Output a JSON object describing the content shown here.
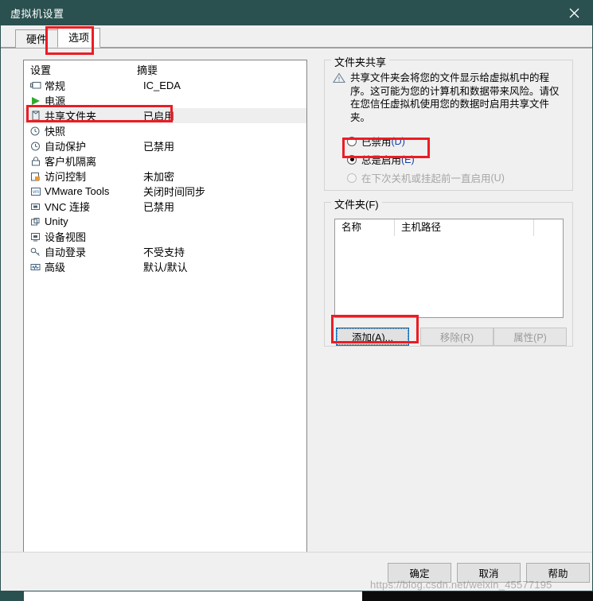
{
  "window": {
    "title": "虚拟机设置",
    "close_icon": "close-icon"
  },
  "tabs": [
    {
      "label": "硬件",
      "active": false
    },
    {
      "label": "选项",
      "active": true
    }
  ],
  "settings_list": {
    "headers": {
      "name": "设置",
      "summary": "摘要"
    },
    "rows": [
      {
        "icon": "monitor-icon",
        "label": "常规",
        "summary": "IC_EDA",
        "selected": false
      },
      {
        "icon": "power-play-icon",
        "label": "电源",
        "summary": "",
        "selected": false
      },
      {
        "icon": "folder-icon",
        "label": "共享文件夹",
        "summary": "已启用",
        "selected": true
      },
      {
        "icon": "snapshot-icon",
        "label": "快照",
        "summary": "",
        "selected": false
      },
      {
        "icon": "clock-icon",
        "label": "自动保护",
        "summary": "已禁用",
        "selected": false
      },
      {
        "icon": "lock-icon",
        "label": "客户机隔离",
        "summary": "",
        "selected": false
      },
      {
        "icon": "access-lock-icon",
        "label": "访问控制",
        "summary": "未加密",
        "selected": false
      },
      {
        "icon": "vm-tools-icon",
        "label": "VMware Tools",
        "summary": "关闭时间同步",
        "selected": false
      },
      {
        "icon": "vnc-icon",
        "label": "VNC 连接",
        "summary": "已禁用",
        "selected": false
      },
      {
        "icon": "unity-icon",
        "label": "Unity",
        "summary": "",
        "selected": false
      },
      {
        "icon": "device-view-icon",
        "label": "设备视图",
        "summary": "",
        "selected": false
      },
      {
        "icon": "key-icon",
        "label": "自动登录",
        "summary": "不受支持",
        "selected": false
      },
      {
        "icon": "advanced-icon",
        "label": "高级",
        "summary": "默认/默认",
        "selected": false
      }
    ]
  },
  "sharing_group": {
    "title": "文件夹共享",
    "warning_icon": "warning-triangle-icon",
    "warning_text": "共享文件夹会将您的文件显示给虚拟机中的程序。这可能为您的计算机和数据带来风险。请仅在您信任虚拟机使用您的数据时启用共享文件夹。",
    "options": [
      {
        "label": "已禁用",
        "mnemonic": "(D)",
        "checked": false,
        "disabled": false
      },
      {
        "label": "总是启用",
        "mnemonic": "(E)",
        "checked": true,
        "disabled": false
      },
      {
        "label": "在下次关机或挂起前一直启用",
        "mnemonic": "(U)",
        "checked": false,
        "disabled": true
      }
    ]
  },
  "folders_group": {
    "title": "文件夹(F)",
    "table": {
      "columns": [
        "名称",
        "主机路径",
        ""
      ],
      "rows": []
    },
    "buttons": [
      {
        "label": "添加(A)...",
        "disabled": false,
        "focused": true
      },
      {
        "label": "移除(R)",
        "disabled": true,
        "focused": false
      },
      {
        "label": "属性(P)",
        "disabled": true,
        "focused": false
      }
    ]
  },
  "footer": {
    "ok": "确定",
    "cancel": "取消",
    "help": "帮助"
  },
  "watermark": "https://blog.csdn.net/weixin_45577195",
  "colors": {
    "titlebar": "#2a5150",
    "accent_focus": "#0078d7",
    "annotation_red": "#ec1c24",
    "mnemonic_blue": "#123ea8",
    "selection_gray": "#eeeeee"
  }
}
